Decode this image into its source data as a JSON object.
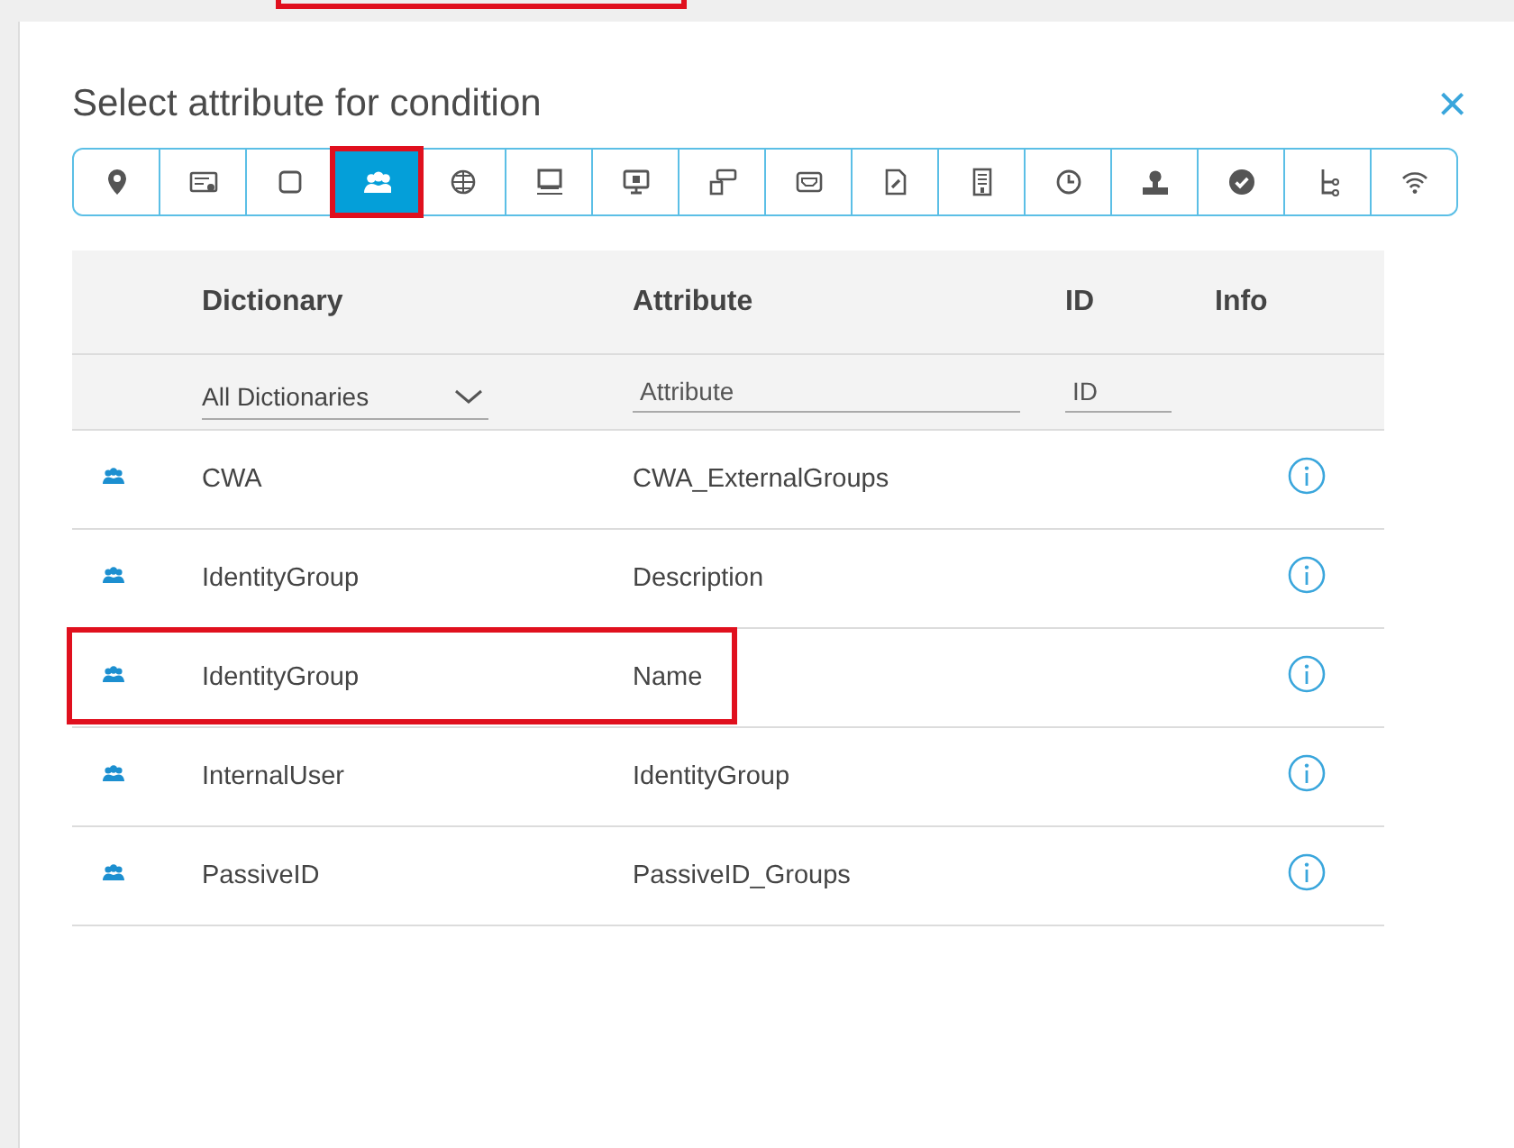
{
  "dialog": {
    "title": "Select attribute for condition",
    "close": "×"
  },
  "toolbar": [
    {
      "selected": false,
      "highlighted": false
    },
    {
      "selected": false,
      "highlighted": false
    },
    {
      "selected": false,
      "highlighted": false
    },
    {
      "selected": true,
      "highlighted": true
    },
    {
      "selected": false,
      "highlighted": false
    },
    {
      "selected": false,
      "highlighted": false
    },
    {
      "selected": false,
      "highlighted": false
    },
    {
      "selected": false,
      "highlighted": false
    },
    {
      "selected": false,
      "highlighted": false
    },
    {
      "selected": false,
      "highlighted": false
    },
    {
      "selected": false,
      "highlighted": false
    },
    {
      "selected": false,
      "highlighted": false
    },
    {
      "selected": false,
      "highlighted": false
    },
    {
      "selected": false,
      "highlighted": false
    },
    {
      "selected": false,
      "highlighted": false
    },
    {
      "selected": false,
      "highlighted": false
    }
  ],
  "table": {
    "columns": [
      "Dictionary",
      "Attribute",
      "ID",
      "Info"
    ],
    "filters": {
      "dictionary": {
        "value": "All Dictionaries"
      },
      "attribute": {
        "placeholder": "Attribute"
      },
      "id": {
        "placeholder": "ID"
      }
    },
    "rows": [
      {
        "dictionary": "CWA",
        "attribute": "CWA_ExternalGroups",
        "highlighted": false
      },
      {
        "dictionary": "IdentityGroup",
        "attribute": "Description",
        "highlighted": false
      },
      {
        "dictionary": "IdentityGroup",
        "attribute": "Name",
        "highlighted": true
      },
      {
        "dictionary": "InternalUser",
        "attribute": "IdentityGroup",
        "highlighted": false
      },
      {
        "dictionary": "PassiveID",
        "attribute": "PassiveID_Groups",
        "highlighted": false
      }
    ]
  }
}
